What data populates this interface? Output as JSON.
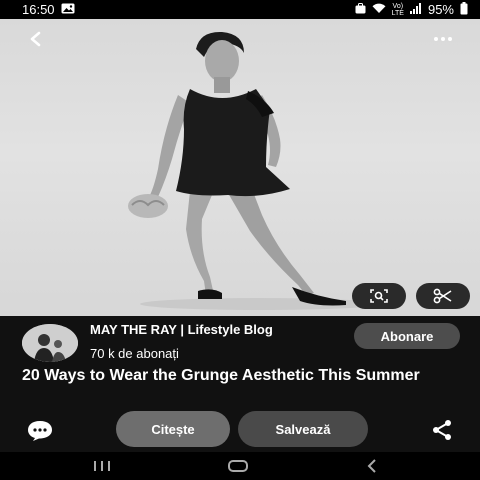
{
  "status_bar": {
    "time": "16:50",
    "network_label_top": "Vo)",
    "network_label_bottom": "LTE",
    "battery": "95%"
  },
  "pin": {
    "image_alt": "Woman in black grunge mini dress and heels",
    "creator_name": "MAY THE RAY | Lifestyle Blog",
    "followers": "70 k de abonați",
    "subscribe_label": "Abonare",
    "title": "20 Ways to Wear the Grunge Aesthetic This Summer",
    "read_label": "Citește",
    "save_label": "Salvează"
  },
  "icons": {
    "back": "back-arrow-icon",
    "more": "more-options-icon",
    "lens": "visual-search-icon",
    "cut": "scissors-icon",
    "comment": "comment-icon",
    "share": "share-icon",
    "nav_recent": "recent-apps-icon",
    "nav_home": "home-icon",
    "nav_back": "nav-back-icon"
  }
}
